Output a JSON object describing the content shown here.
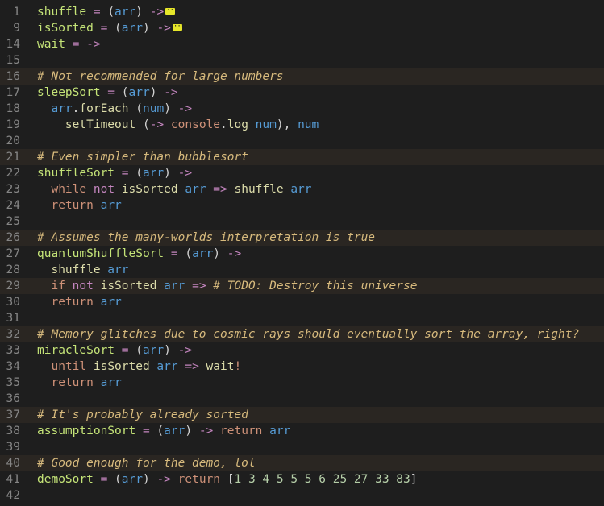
{
  "editor": {
    "lines": [
      {
        "num": "1",
        "segments": [
          {
            "t": "shuffle",
            "c": "t-fn"
          },
          {
            "t": " = ",
            "c": "t-op"
          },
          {
            "t": "(",
            "c": "t-paren"
          },
          {
            "t": "arr",
            "c": "t-param"
          },
          {
            "t": ") ",
            "c": "t-paren"
          },
          {
            "t": "->",
            "c": "t-op"
          }
        ],
        "fold": true
      },
      {
        "num": "9",
        "segments": [
          {
            "t": "isSorted",
            "c": "t-fn"
          },
          {
            "t": " = ",
            "c": "t-op"
          },
          {
            "t": "(",
            "c": "t-paren"
          },
          {
            "t": "arr",
            "c": "t-param"
          },
          {
            "t": ") ",
            "c": "t-paren"
          },
          {
            "t": "->",
            "c": "t-op"
          }
        ],
        "fold": true
      },
      {
        "num": "14",
        "segments": [
          {
            "t": "wait",
            "c": "t-fn"
          },
          {
            "t": " = ",
            "c": "t-op"
          },
          {
            "t": "->",
            "c": "t-op"
          }
        ]
      },
      {
        "num": "15",
        "segments": []
      },
      {
        "num": "16",
        "comment": true,
        "segments": [
          {
            "t": "# Not recommended for large numbers",
            "c": "t-comment"
          }
        ]
      },
      {
        "num": "17",
        "segments": [
          {
            "t": "sleepSort",
            "c": "t-fn"
          },
          {
            "t": " = ",
            "c": "t-op"
          },
          {
            "t": "(",
            "c": "t-paren"
          },
          {
            "t": "arr",
            "c": "t-param"
          },
          {
            "t": ") ",
            "c": "t-paren"
          },
          {
            "t": "->",
            "c": "t-op"
          }
        ]
      },
      {
        "num": "18",
        "segments": [
          {
            "t": "  ",
            "c": "t-dots"
          },
          {
            "t": "arr",
            "c": "t-param"
          },
          {
            "t": ".",
            "c": "t-plain"
          },
          {
            "t": "forEach",
            "c": "t-call"
          },
          {
            "t": " (",
            "c": "t-paren"
          },
          {
            "t": "num",
            "c": "t-param"
          },
          {
            "t": ") ",
            "c": "t-paren"
          },
          {
            "t": "->",
            "c": "t-op"
          }
        ]
      },
      {
        "num": "19",
        "segments": [
          {
            "t": "    ",
            "c": "t-dots"
          },
          {
            "t": "setTimeout",
            "c": "t-call"
          },
          {
            "t": " (",
            "c": "t-paren"
          },
          {
            "t": "->",
            "c": "t-op"
          },
          {
            "t": " console",
            "c": "t-kw"
          },
          {
            "t": ".",
            "c": "t-plain"
          },
          {
            "t": "log",
            "c": "t-call"
          },
          {
            "t": " num",
            "c": "t-param"
          },
          {
            "t": "), ",
            "c": "t-paren"
          },
          {
            "t": "num",
            "c": "t-param"
          }
        ]
      },
      {
        "num": "20",
        "segments": []
      },
      {
        "num": "21",
        "comment": true,
        "segments": [
          {
            "t": "# Even simpler than bubblesort",
            "c": "t-comment"
          }
        ]
      },
      {
        "num": "22",
        "segments": [
          {
            "t": "shuffleSort",
            "c": "t-fn"
          },
          {
            "t": " = ",
            "c": "t-op"
          },
          {
            "t": "(",
            "c": "t-paren"
          },
          {
            "t": "arr",
            "c": "t-param"
          },
          {
            "t": ") ",
            "c": "t-paren"
          },
          {
            "t": "->",
            "c": "t-op"
          }
        ]
      },
      {
        "num": "23",
        "segments": [
          {
            "t": "  ",
            "c": "t-dots"
          },
          {
            "t": "while",
            "c": "t-kw"
          },
          {
            "t": " not",
            "c": "t-op"
          },
          {
            "t": " isSorted",
            "c": "t-call"
          },
          {
            "t": " arr",
            "c": "t-param"
          },
          {
            "t": " =>",
            "c": "t-op"
          },
          {
            "t": " shuffle",
            "c": "t-call"
          },
          {
            "t": " arr",
            "c": "t-param"
          }
        ]
      },
      {
        "num": "24",
        "segments": [
          {
            "t": "  ",
            "c": "t-dots"
          },
          {
            "t": "return",
            "c": "t-kw"
          },
          {
            "t": " arr",
            "c": "t-param"
          }
        ]
      },
      {
        "num": "25",
        "segments": []
      },
      {
        "num": "26",
        "comment": true,
        "segments": [
          {
            "t": "# Assumes the many-worlds interpretation is true",
            "c": "t-comment"
          }
        ]
      },
      {
        "num": "27",
        "segments": [
          {
            "t": "quantumShuffleSort",
            "c": "t-fn"
          },
          {
            "t": " = ",
            "c": "t-op"
          },
          {
            "t": "(",
            "c": "t-paren"
          },
          {
            "t": "arr",
            "c": "t-param"
          },
          {
            "t": ") ",
            "c": "t-paren"
          },
          {
            "t": "->",
            "c": "t-op"
          }
        ]
      },
      {
        "num": "28",
        "segments": [
          {
            "t": "  ",
            "c": "t-dots"
          },
          {
            "t": "shuffle",
            "c": "t-call"
          },
          {
            "t": " arr",
            "c": "t-param"
          }
        ]
      },
      {
        "num": "29",
        "comment": true,
        "segments": [
          {
            "t": "  ",
            "c": "t-dots"
          },
          {
            "t": "if",
            "c": "t-kw"
          },
          {
            "t": " not",
            "c": "t-op"
          },
          {
            "t": " isSorted",
            "c": "t-call"
          },
          {
            "t": " arr",
            "c": "t-param"
          },
          {
            "t": " =>",
            "c": "t-op"
          },
          {
            "t": " # TODO: Destroy this universe",
            "c": "t-comment"
          }
        ]
      },
      {
        "num": "30",
        "segments": [
          {
            "t": "  ",
            "c": "t-dots"
          },
          {
            "t": "return",
            "c": "t-kw"
          },
          {
            "t": " arr",
            "c": "t-param"
          }
        ]
      },
      {
        "num": "31",
        "segments": []
      },
      {
        "num": "32",
        "comment": true,
        "segments": [
          {
            "t": "# Memory glitches due to cosmic rays should eventually sort the array, right?",
            "c": "t-comment"
          }
        ]
      },
      {
        "num": "33",
        "segments": [
          {
            "t": "miracleSort",
            "c": "t-fn"
          },
          {
            "t": " = ",
            "c": "t-op"
          },
          {
            "t": "(",
            "c": "t-paren"
          },
          {
            "t": "arr",
            "c": "t-param"
          },
          {
            "t": ") ",
            "c": "t-paren"
          },
          {
            "t": "->",
            "c": "t-op"
          }
        ]
      },
      {
        "num": "34",
        "segments": [
          {
            "t": "  ",
            "c": "t-dots"
          },
          {
            "t": "until",
            "c": "t-kw"
          },
          {
            "t": " isSorted",
            "c": "t-call"
          },
          {
            "t": " arr",
            "c": "t-param"
          },
          {
            "t": " =>",
            "c": "t-op"
          },
          {
            "t": " wait",
            "c": "t-call"
          },
          {
            "t": "!",
            "c": "t-kw"
          }
        ]
      },
      {
        "num": "35",
        "segments": [
          {
            "t": "  ",
            "c": "t-dots"
          },
          {
            "t": "return",
            "c": "t-kw"
          },
          {
            "t": " arr",
            "c": "t-param"
          }
        ]
      },
      {
        "num": "36",
        "segments": []
      },
      {
        "num": "37",
        "comment": true,
        "segments": [
          {
            "t": "# It's probably already sorted",
            "c": "t-comment"
          }
        ]
      },
      {
        "num": "38",
        "segments": [
          {
            "t": "assumptionSort",
            "c": "t-fn"
          },
          {
            "t": " = ",
            "c": "t-op"
          },
          {
            "t": "(",
            "c": "t-paren"
          },
          {
            "t": "arr",
            "c": "t-param"
          },
          {
            "t": ") ",
            "c": "t-paren"
          },
          {
            "t": "->",
            "c": "t-op"
          },
          {
            "t": " return",
            "c": "t-kw"
          },
          {
            "t": " arr",
            "c": "t-param"
          }
        ]
      },
      {
        "num": "39",
        "segments": []
      },
      {
        "num": "40",
        "comment": true,
        "segments": [
          {
            "t": "# Good enough for the demo, lol",
            "c": "t-comment"
          }
        ]
      },
      {
        "num": "41",
        "segments": [
          {
            "t": "demoSort",
            "c": "t-fn"
          },
          {
            "t": " = ",
            "c": "t-op"
          },
          {
            "t": "(",
            "c": "t-paren"
          },
          {
            "t": "arr",
            "c": "t-param"
          },
          {
            "t": ") ",
            "c": "t-paren"
          },
          {
            "t": "->",
            "c": "t-op"
          },
          {
            "t": " return",
            "c": "t-kw"
          },
          {
            "t": " [",
            "c": "t-bracket"
          },
          {
            "t": "1 3 4 5 5 5 6 25 27 33 83",
            "c": "t-num"
          },
          {
            "t": "]",
            "c": "t-bracket"
          }
        ]
      },
      {
        "num": "42",
        "segments": []
      }
    ]
  },
  "colors": {
    "background": "#1e1e1e",
    "comment_line_background": "#2a2622",
    "line_number": "#858585"
  }
}
